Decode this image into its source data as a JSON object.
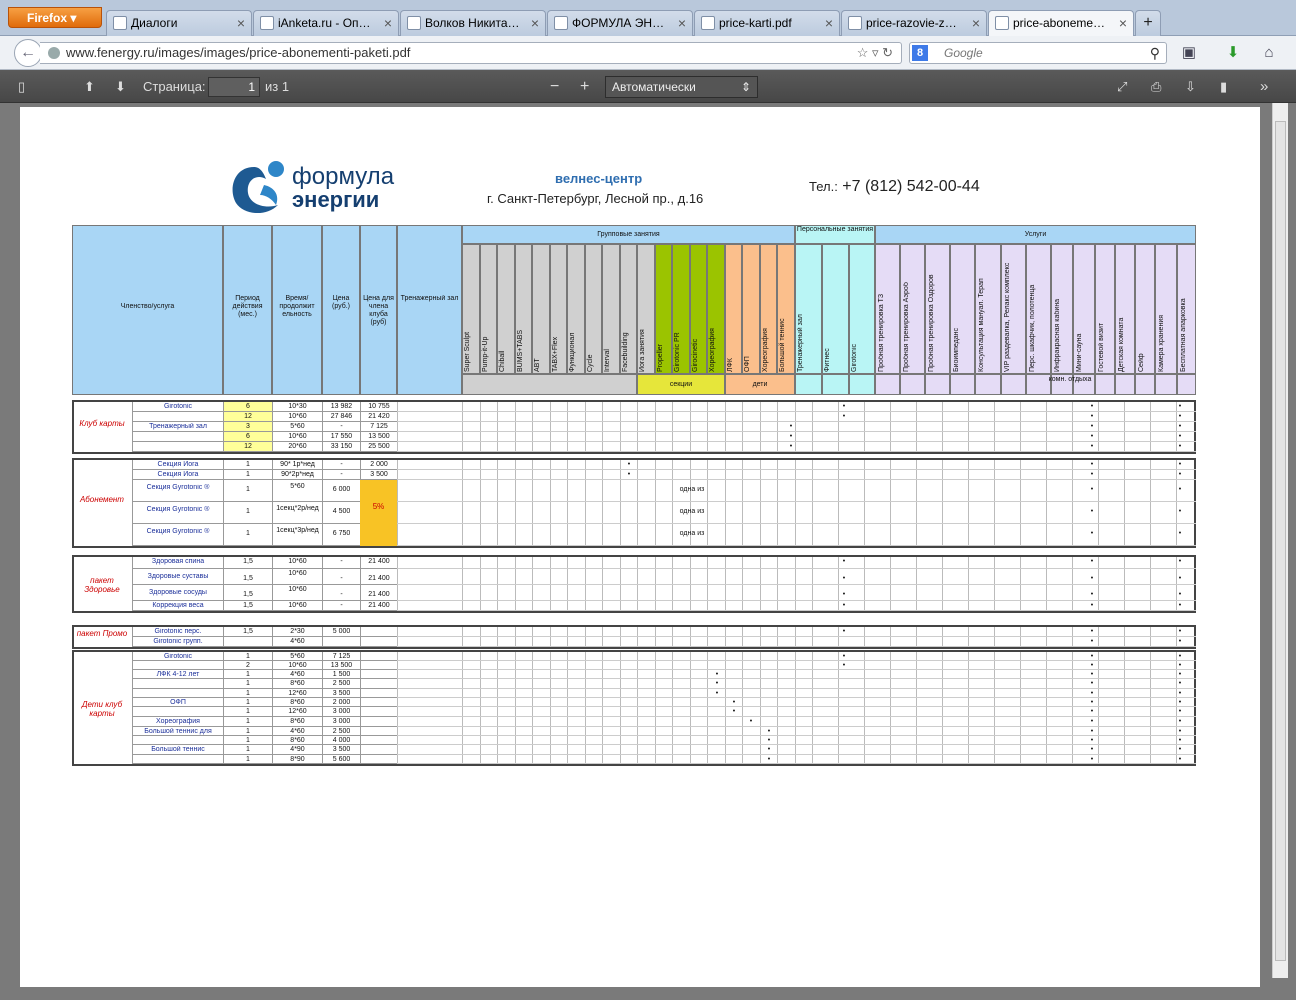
{
  "browser": {
    "menu_button": "Firefox",
    "tabs": [
      {
        "label": "Диалоги",
        "icon": "chat-icon"
      },
      {
        "label": "iAnketa.ru - Опр...",
        "icon": "site-icon"
      },
      {
        "label": "Волков Никита А...",
        "icon": "outlook-icon"
      },
      {
        "label": "ФОРМУЛА ЭНЕР...",
        "icon": "site-icon"
      },
      {
        "label": "price-karti.pdf",
        "icon": "document-icon"
      },
      {
        "label": "price-razovie-zan...",
        "icon": "document-icon"
      },
      {
        "label": "price-abonement...",
        "icon": "document-icon",
        "active": true
      }
    ],
    "new_tab": "+",
    "url": "www.fenergy.ru/images/images/price-abonementi-paketi.pdf",
    "search_placeholder": "Google"
  },
  "pdf_toolbar": {
    "page_label": "Страница:",
    "page_value": "1",
    "page_total": "из 1",
    "zoom_value": "Автоматически",
    "zoom_minus": "−",
    "zoom_plus": "+"
  },
  "doc": {
    "brand_line1": "формула",
    "brand_line2": "энергии",
    "wellness": "велнес-центр",
    "address": "г. Санкт-Петербург, Лесной пр., д.16",
    "phone_prefix": "Тел.:",
    "phone": "+7 (812) 542-00-44",
    "header": {
      "col_service": "Членство/услуга",
      "col_period": "Период действия (мес.)",
      "col_time": "Время/ продолжит ельность",
      "col_price": "Цена (руб.)",
      "col_member_price": "Цена для члена клуба (руб)",
      "col_gym": "Тренажерный зал",
      "group_classes": "Групповые занятия",
      "personal": "Персональные занятия",
      "services": "Услуги",
      "sections_label": "секции",
      "children_label": "дети",
      "rest_room": "комн. отдыха",
      "group_cols": [
        "Super Sculpt",
        "Pump-it-Up",
        "Chiball",
        "BUMS+TABS",
        "ABT",
        "TABX+Flex",
        "Функционал",
        "Cycle",
        "Interval",
        "Facebuilding",
        "Йога занятия",
        "Propeller",
        "Girotonic PR",
        "Girocinetic",
        "Хореография",
        "ЛФК",
        "ОФП",
        "Хореография",
        "Большой теннис"
      ],
      "personal_cols": [
        "Тренажерный зал",
        "Фитнес",
        "Girotonic"
      ],
      "service_cols": [
        "Пробная тренировка ТЗ",
        "Пробная тренировка Аэроб",
        "Пробная тренировка Оздоров",
        "Биоимпеданс",
        "Консультация мануал. Терап",
        "VIP раздевалка, Релакс комплекс",
        "Перс. шкафчик, полотенца",
        "Инфракрасная кабина",
        "Мини-сауна",
        "Гостевой визит",
        "Детская комната",
        "Сейф",
        "Камера хранения",
        "Бесплатная апарковка"
      ]
    },
    "sections": [
      {
        "name": "Клуб карты",
        "rows": [
          [
            "Girotonic",
            "6",
            "10*30",
            "13 982",
            "10 755"
          ],
          [
            "",
            "12",
            "10*60",
            "27 846",
            "21 420"
          ],
          [
            "Тренажерный зал",
            "3",
            "5*60",
            "-",
            "7 125"
          ],
          [
            "",
            "6",
            "10*60",
            "17 550",
            "13 500"
          ],
          [
            "",
            "12",
            "20*60",
            "33 150",
            "25 500"
          ]
        ]
      },
      {
        "name": "Абонемент",
        "rows": [
          [
            "Секция Йога",
            "1",
            "90* 1р*нед",
            "-",
            "2 000"
          ],
          [
            "Секция Йога",
            "1",
            "90*2р*нед",
            "-",
            "3 500"
          ],
          [
            "Секция Gyrotonic ®",
            "1",
            "5*60",
            "6 000",
            ""
          ],
          [
            "Секция Gyrotonic ®",
            "1",
            "1секц*2р/нед",
            "4 500",
            "5%"
          ],
          [
            "Секция Gyrotonic ®",
            "1",
            "1секц*3р/нед",
            "6 750",
            ""
          ]
        ],
        "one_of": "одна из"
      },
      {
        "name": "пакет Здоровье",
        "rows": [
          [
            "Здоровая спина",
            "1,5",
            "10*60",
            "-",
            "21 400"
          ],
          [
            "Здоровые суставы",
            "1,5",
            "10*60",
            "-",
            "21 400"
          ],
          [
            "Здоровые сосуды",
            "1,5",
            "10*60",
            "-",
            "21 400"
          ],
          [
            "Коррекция веса",
            "1,5",
            "10*60",
            "-",
            "21 400"
          ]
        ]
      },
      {
        "name": "пакет Промо",
        "rows": [
          [
            "Girotonic перс.",
            "1,5",
            "2*30",
            "5 000",
            ""
          ],
          [
            "Girotonic групп.",
            "",
            "4*60",
            "",
            ""
          ]
        ]
      },
      {
        "name": "Дети клуб карты",
        "rows": [
          [
            "Girotonic",
            "1",
            "5*60",
            "7 125"
          ],
          [
            "",
            "2",
            "10*60",
            "13 500"
          ],
          [
            "ЛФК 4-12 лет",
            "1",
            "4*60",
            "1 500"
          ],
          [
            "",
            "1",
            "8*60",
            "2 500"
          ],
          [
            "",
            "1",
            "12*60",
            "3 500"
          ],
          [
            "ОФП",
            "1",
            "8*60",
            "2 000"
          ],
          [
            "",
            "1",
            "12*60",
            "3 000"
          ],
          [
            "Хореография",
            "1",
            "8*60",
            "3 000"
          ],
          [
            "Большой теннис для начинающих",
            "1",
            "4*60",
            "2 500"
          ],
          [
            "",
            "1",
            "8*60",
            "4 000"
          ],
          [
            "Большой теннис",
            "1",
            "4*90",
            "3 500"
          ],
          [
            "",
            "1",
            "8*90",
            "5 600"
          ]
        ]
      }
    ]
  }
}
